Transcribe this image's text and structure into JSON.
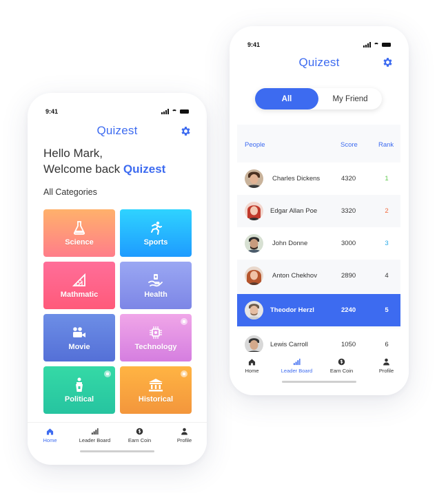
{
  "left_phone": {
    "status_time": "9:41",
    "logo_text": "Quizest",
    "greeting_line1": "Hello Mark,",
    "greeting_line2_prefix": "Welcome back ",
    "greeting_brand": "Quizest",
    "categories_title": "All Categories",
    "categories": [
      {
        "label": "Science",
        "icon": "flask-icon",
        "locked": false
      },
      {
        "label": "Sports",
        "icon": "runner-icon",
        "locked": false
      },
      {
        "label": "Mathmatic",
        "icon": "ruler-icon",
        "locked": false
      },
      {
        "label": "Health",
        "icon": "health-icon",
        "locked": false
      },
      {
        "label": "Movie",
        "icon": "camera-icon",
        "locked": false
      },
      {
        "label": "Technology",
        "icon": "chip-icon",
        "locked": true
      },
      {
        "label": "Political",
        "icon": "podium-icon",
        "locked": true
      },
      {
        "label": "Historical",
        "icon": "museum-icon",
        "locked": true
      }
    ],
    "nav": [
      {
        "label": "Home",
        "icon": "home-icon",
        "active": true
      },
      {
        "label": "Leader Board",
        "icon": "bar-chart-icon",
        "active": false
      },
      {
        "label": "Earn Coin",
        "icon": "coin-icon",
        "active": false
      },
      {
        "label": "Profile",
        "icon": "profile-icon",
        "active": false
      }
    ]
  },
  "right_phone": {
    "status_time": "9:41",
    "logo_text": "Quizest",
    "toggle": {
      "all": "All",
      "friends": "My Friend",
      "selected": "All"
    },
    "headers": {
      "people": "People",
      "score": "Score",
      "rank": "Rank"
    },
    "rows": [
      {
        "name": "Charles Dickens",
        "score": "4320",
        "rank": "1",
        "rank_color": "#5cc84a",
        "selected": false
      },
      {
        "name": "Edgar Allan Poe",
        "score": "3320",
        "rank": "2",
        "rank_color": "#f26a3c",
        "selected": false
      },
      {
        "name": "John Donne",
        "score": "3000",
        "rank": "3",
        "rank_color": "#27a9e8",
        "selected": false
      },
      {
        "name": "Anton Chekhov",
        "score": "2890",
        "rank": "4",
        "rank_color": "#333333",
        "selected": false
      },
      {
        "name": "Theodor Herzl",
        "score": "2240",
        "rank": "5",
        "rank_color": "#ffffff",
        "selected": true
      },
      {
        "name": "Lewis Carroll",
        "score": "1050",
        "rank": "6",
        "rank_color": "#333333",
        "selected": false
      }
    ],
    "nav": [
      {
        "label": "Home",
        "icon": "home-icon",
        "active": false
      },
      {
        "label": "Leader Board",
        "icon": "bar-chart-icon",
        "active": true
      },
      {
        "label": "Earn Coin",
        "icon": "coin-icon",
        "active": false
      },
      {
        "label": "Profile",
        "icon": "profile-icon",
        "active": false
      }
    ]
  },
  "colors": {
    "accent": "#3d6bf0"
  }
}
